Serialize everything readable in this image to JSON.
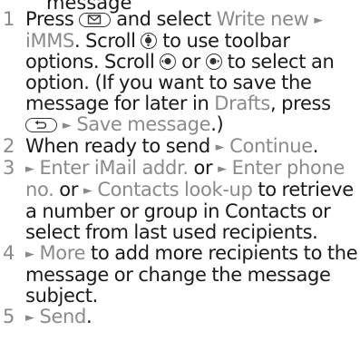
{
  "heading_fragment": "message",
  "steps": [
    {
      "number": "1",
      "parts": {
        "t1": "Press",
        "t2": "and select",
        "c1": "Write new",
        "c2": "iMMS",
        "t3": ". Scroll",
        "t4": "to use toolbar options. Scroll",
        "t5": "or",
        "t6": "to select an option. (If you want to save the message for later in",
        "c3": "Drafts",
        "t7": ", press",
        "c4": "Save message",
        "t8": ".)"
      }
    },
    {
      "number": "2",
      "parts": {
        "t1": "When ready to send",
        "c1": "Continue",
        "t2": "."
      }
    },
    {
      "number": "3",
      "parts": {
        "c1": "Enter iMail addr.",
        "t1": "or",
        "c2": "Enter phone no.",
        "t2": "or",
        "c3": "Contacts look-up",
        "t3": "to retrieve a number or group in Contacts or select from last used recipients."
      }
    },
    {
      "number": "4",
      "parts": {
        "c1": "More",
        "t1": "to add more recipients to the message or change the message subject."
      }
    },
    {
      "number": "5",
      "parts": {
        "c1": "Send",
        "t1": "."
      }
    }
  ],
  "arrow_glyph": "►",
  "icons": {
    "message_key": "envelope-key-icon",
    "scroll_updown": "nav-updown-icon",
    "scroll_left": "nav-left-icon",
    "scroll_right": "nav-right-icon",
    "back_key": "back-key-icon"
  },
  "colors": {
    "text": "#1a1a1a",
    "command": "#8a8a8a"
  }
}
